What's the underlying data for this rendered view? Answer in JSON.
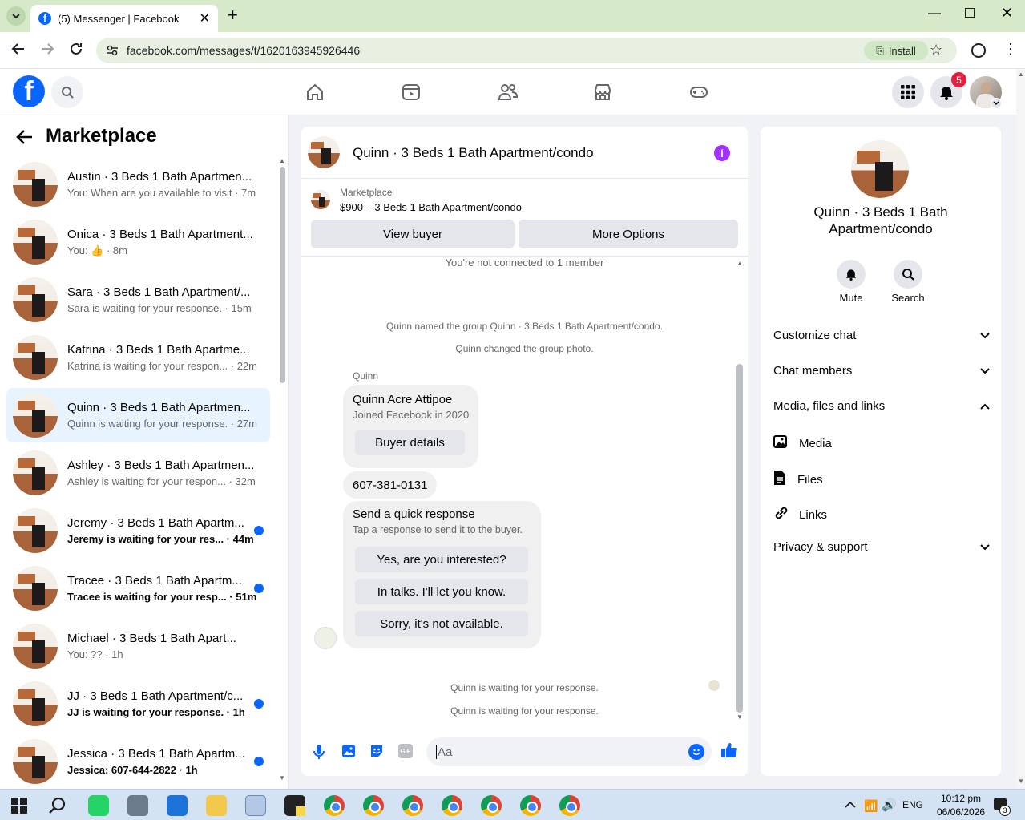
{
  "browser": {
    "tab_title": "(5) Messenger | Facebook",
    "url": "facebook.com/messages/t/1620163945926446",
    "install_label": "Install"
  },
  "fbnav": {
    "notification_count": "5"
  },
  "left": {
    "title": "Marketplace",
    "conversations": [
      {
        "name": "Austin · 3 Beds 1 Bath Apartmen...",
        "sub": "You: When are you available to visit · 7m",
        "unread": false,
        "selected": false
      },
      {
        "name": "Onica · 3 Beds 1 Bath Apartment...",
        "sub": "You: 👍 · 8m",
        "unread": false,
        "selected": false
      },
      {
        "name": "Sara · 3 Beds 1 Bath Apartment/...",
        "sub": "Sara is waiting for your response. · 15m",
        "unread": false,
        "selected": false
      },
      {
        "name": "Katrina · 3 Beds 1 Bath Apartme...",
        "sub": "Katrina is waiting for your respon... · 22m",
        "unread": false,
        "selected": false
      },
      {
        "name": "Quinn · 3 Beds 1 Bath Apartmen...",
        "sub": "Quinn is waiting for your response. · 27m",
        "unread": false,
        "selected": true
      },
      {
        "name": "Ashley · 3 Beds 1 Bath Apartmen...",
        "sub": "Ashley is waiting for your respon... · 32m",
        "unread": false,
        "selected": false
      },
      {
        "name": "Jeremy · 3 Beds 1 Bath Apartm...",
        "sub": "Jeremy is waiting for your res... · 44m",
        "unread": true,
        "selected": false
      },
      {
        "name": "Tracee · 3 Beds 1 Bath Apartm...",
        "sub": "Tracee is waiting for your resp... · 51m",
        "unread": true,
        "selected": false
      },
      {
        "name": "Michael · 3 Beds 1 Bath Apart...",
        "sub": "You: ?? · 1h",
        "unread": false,
        "selected": false
      },
      {
        "name": "JJ · 3 Beds 1 Bath Apartment/c...",
        "sub": "JJ is waiting for your response. · 1h",
        "unread": true,
        "selected": false
      },
      {
        "name": "Jessica · 3 Beds 1 Bath Apartm...",
        "sub": "Jessica: 607-644-2822 · 1h",
        "unread": true,
        "selected": false
      }
    ]
  },
  "chat": {
    "title": "Quinn · 3 Beds 1 Bath Apartment/condo",
    "listing_source": "Marketplace",
    "listing_title": "$900 – 3 Beds 1 Bath Apartment/condo",
    "view_buyer": "View buyer",
    "more_options": "More Options",
    "not_connected": "You're not connected to 1 member",
    "sys_named": "Quinn named the group Quinn · 3 Beds 1 Bath Apartment/condo.",
    "sys_photo": "Quinn changed the group photo.",
    "sender": "Quinn",
    "buyer_name": "Quinn Acre Attipoe",
    "buyer_joined": "Joined Facebook in 2020",
    "buyer_details": "Buyer details",
    "phone": "607-381-0131",
    "quick_title": "Send a quick response",
    "quick_sub": "Tap a response to send it to the buyer.",
    "quick_1": "Yes, are you interested?",
    "quick_2": "In talks. I'll let you know.",
    "quick_3": "Sorry, it's not available.",
    "waiting_1": "Quinn is waiting for your response.",
    "waiting_2": "Quinn is waiting for your response.",
    "input_placeholder": "Aa",
    "gif_label": "GIF"
  },
  "right": {
    "title": "Quinn · 3 Beds 1 Bath Apartment/condo",
    "mute": "Mute",
    "search": "Search",
    "customize": "Customize chat",
    "members": "Chat members",
    "media_section": "Media, files and links",
    "media": "Media",
    "files": "Files",
    "links": "Links",
    "privacy": "Privacy & support"
  },
  "taskbar": {
    "lang": "ENG",
    "time": "10:12 pm",
    "date": "06/06/2026",
    "notif_count": "3"
  },
  "colors": {
    "accent": "#0866ff",
    "messenger_purple": "#a033ff",
    "chrome_tab_bg": "#d6e9c9"
  }
}
